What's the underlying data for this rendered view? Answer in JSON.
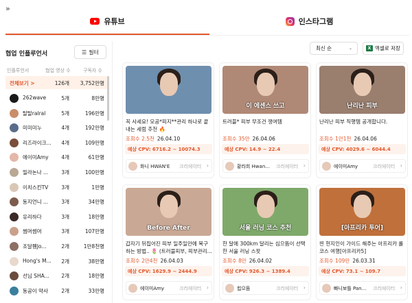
{
  "nav": {
    "collapse_icon": "double-chevron-right-icon",
    "collapse_glyph": "»"
  },
  "tabs": [
    {
      "label": "유튜브",
      "icon": "youtube-icon",
      "active": true
    },
    {
      "label": "인스타그램",
      "icon": "instagram-icon",
      "active": false
    }
  ],
  "colors": {
    "accent": "#e2582d",
    "youtube": "#ff0000",
    "excel": "#1e7b45"
  },
  "left_panel": {
    "title": "협업 인플루언서",
    "filter_label": "필터",
    "headers": {
      "name": "인플루언서",
      "count": "협업 영상 수",
      "subs": "구독자 수"
    },
    "all_row": {
      "name": "전체보기",
      "chevron": ">",
      "count": "126개",
      "subs": "3,752만명"
    },
    "rows": [
      {
        "name": "262wave",
        "count": "5개",
        "subs": "8만명",
        "avatar_color": "#1a1a1a"
      },
      {
        "name": "탈탈ralral",
        "count": "5개",
        "subs": "196만명",
        "avatar_color": "#c98d6a"
      },
      {
        "name": "미미미누",
        "count": "4개",
        "subs": "192만명",
        "avatar_color": "#5a6c8a"
      },
      {
        "name": "리즈라이크...",
        "count": "4개",
        "subs": "109만명",
        "avatar_color": "#7a4e3b"
      },
      {
        "name": "에이미Amy",
        "count": "4개",
        "subs": "61만명",
        "avatar_color": "#e4b7a8"
      },
      {
        "name": "밀라논나 ...",
        "count": "3개",
        "subs": "100만명",
        "avatar_color": "#b8a894"
      },
      {
        "name": "이치스킨TV",
        "count": "3개",
        "subs": "1만명",
        "avatar_color": "#d9c7b6"
      },
      {
        "name": "동지언니 ...",
        "count": "3개",
        "subs": "34만명",
        "avatar_color": "#7d5c4d"
      },
      {
        "name": "유리하다",
        "count": "3개",
        "subs": "18만명",
        "avatar_color": "#3b2a26"
      },
      {
        "name": "썸머썸머",
        "count": "3개",
        "subs": "107만명",
        "avatar_color": "#caa08a"
      },
      {
        "name": "조달퀜Jo...",
        "count": "2개",
        "subs": "1만8천명",
        "avatar_color": "#8d6f64"
      },
      {
        "name": "Hong's M...",
        "count": "2개",
        "subs": "38만명",
        "avatar_color": "#e8d9cc"
      },
      {
        "name": "선님 SHA...",
        "count": "2개",
        "subs": "18만명",
        "avatar_color": "#6a4c3f"
      },
      {
        "name": "동공이 약사",
        "count": "2개",
        "subs": "33만명",
        "avatar_color": "#3a7f9e"
      }
    ]
  },
  "toolbar": {
    "sort_label": "최신 순",
    "sort_chevron": "⌄",
    "excel_label": "엑셀로 저장",
    "excel_icon_text": "X"
  },
  "cards": [
    {
      "title": "꼭 사세요! 모공*피지**관리 하나로 끝내는 세럼 추천 🔥",
      "views": "조회수 2.5천",
      "date": "26.04.10",
      "cpv": "예상 CPV: 6716.2 ~ 10074.3",
      "creator": "화니 HWAN'E",
      "role": "크리에이터",
      "thumb_bg": "#6f8fae",
      "thumb_text": ""
    },
    {
      "title": "트러블* 피부 무조건 쟁여템",
      "views": "조회수 35만",
      "date": "26.04.06",
      "cpv": "예상 CPV: 14.9 ~ 22.4",
      "creator": "황라희 Hwan...",
      "role": "크리에이터",
      "thumb_bg": "#b08976",
      "thumb_text": "이 에센스 쓰고"
    },
    {
      "title": "난리난 피부 직행템 공개합니다.",
      "views": "조회수 1만1천",
      "date": "26.04.06",
      "cpv": "예상 CPV: 4029.6 ~ 6044.4",
      "creator": "에이미Amy",
      "role": "크리에이터",
      "thumb_bg": "#9a7e6e",
      "thumb_text": "난리난 피부"
    },
    {
      "title": "갑자기 뒤집어진 피부 일주일만에 복구하는 방법.. 🌷 (트러블피부, 피부관리...",
      "views": "조회수 2만4천",
      "date": "26.04.03",
      "cpv": "예상 CPV: 1629.9 ~ 2444.9",
      "creator": "에이미Amy",
      "role": "크리에이터",
      "thumb_bg": "#c9a996",
      "thumb_text": "Before      After"
    },
    {
      "title": "한 달에 300km 달리는 심으뜸이 선택한 서울 러닝 스팟",
      "views": "조회수 8만",
      "date": "26.04.02",
      "cpv": "예상 CPV: 926.3 ~ 1389.4",
      "creator": "힙으뜸",
      "role": "크리에이터",
      "thumb_bg": "#7fa96a",
      "thumb_text": "서울 러닝 코스 추천"
    },
    {
      "title": "찐 현지인이 가이드 해주는 아프리카 롤코스 여행[아프리카5]",
      "views": "조회수 109만",
      "date": "26.03.31",
      "cpv": "예상 CPV: 73.1 ~ 109.7",
      "creator": "빠니보틀 Pan...",
      "role": "크리에이터",
      "thumb_bg": "#c0703b",
      "thumb_text": "[아프리카 투어]"
    }
  ],
  "creator_chevron": "›"
}
